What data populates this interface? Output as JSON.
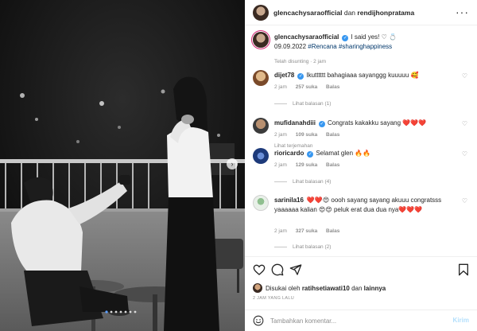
{
  "header": {
    "username": "glencachysaraofficial",
    "connector": "dan",
    "collaborator": "rendijhonpratama",
    "more_icon": "more-horizontal-icon"
  },
  "caption": {
    "username": "glencachysaraofficial",
    "text": "I said yes! ♡ 💍",
    "date": "09.09.2022",
    "hashtags": "#Rencana #sharinghappiness",
    "edited": "Telah disunting · 2 jam"
  },
  "comments": [
    {
      "username": "dijet78",
      "text": "Ikutttttt bahagiaaa sayanggg kuuuuu 🥰",
      "time": "2 jam",
      "likes": "257 suka",
      "reply": "Balas",
      "view_replies": "Lihat balasan (1)"
    },
    {
      "username": "mufidanahdiii",
      "text": "Congrats kakakku sayang ❤️❤️❤️",
      "time": "2 jam",
      "likes": "109 suka",
      "reply": "Balas",
      "view_replies": "Lihat terjemahan"
    },
    {
      "username": "rioricardo",
      "text": "Selamat glen 🔥🔥",
      "time": "2 jam",
      "likes": "129 suka",
      "reply": "Balas",
      "view_replies": "Lihat balasan (4)"
    },
    {
      "username": "sarinila16",
      "text": "❤️❤️😍 oooh sayang sayang akuuu congratsss yaaaaaa kalian 😍😍 peluk erat dua dua nya❤️❤️❤️",
      "time": "2 jam",
      "likes": "327 suka",
      "reply": "Balas",
      "view_replies": "Lihat balasan (2)"
    }
  ],
  "likes_line": {
    "prefix": "Disukai oleh",
    "user": "ratihsetiawati10",
    "connector": "dan",
    "others": "lainnya"
  },
  "timestamp": "2 jam yang lalu",
  "add_comment": {
    "placeholder": "Tambahkan komentar...",
    "post_label": "Kirim"
  },
  "colors": {
    "link": "#00376b",
    "verified": "#3897f0",
    "post_button_disabled": "#b2dffc",
    "muted_text": "#8e8e8e"
  }
}
